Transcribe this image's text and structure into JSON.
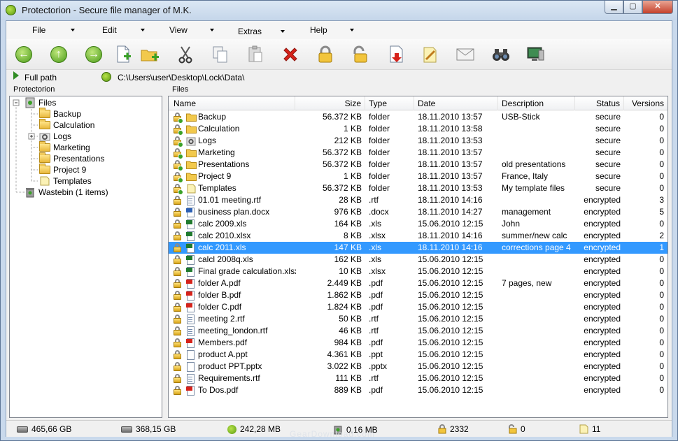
{
  "window": {
    "title": "Protectorion - Secure file manager of M.K.",
    "minimize": "▁",
    "maximize": "▢",
    "close": "✕"
  },
  "menu": [
    {
      "label": "File"
    },
    {
      "label": "Edit"
    },
    {
      "label": "View"
    },
    {
      "label": "Extras"
    },
    {
      "label": "Help"
    }
  ],
  "toolbar": [
    "back-icon",
    "up-icon",
    "forward-icon",
    "new-file-icon",
    "new-folder-icon",
    "cut-icon",
    "copy-icon",
    "paste-icon",
    "delete-icon",
    "lock-icon",
    "unlock-icon",
    "download-icon",
    "edit-note-icon",
    "email-icon",
    "binoculars-icon",
    "monitor-icon"
  ],
  "pathbar": {
    "full_path_label": "Full path",
    "path": "C:\\Users\\user\\Desktop\\Lock\\Data\\"
  },
  "panels": {
    "tree_title": "Protectorion",
    "list_title": "Files"
  },
  "tree": {
    "root": "Files",
    "children": [
      "Backup",
      "Calculation",
      "Logs",
      "Marketing",
      "Presentations",
      "Project 9",
      "Templates"
    ],
    "wastebin": "Wastebin (1 items)"
  },
  "columns": {
    "name": "Name",
    "size": "Size",
    "type": "Type",
    "date": "Date",
    "description": "Description",
    "status": "Status",
    "versions": "Versions"
  },
  "files": [
    {
      "name": "Backup",
      "size": "56.372 KB",
      "type": "folder",
      "date": "18.11.2010 13:57",
      "description": "USB-Stick",
      "status": "secure",
      "versions": "0",
      "icon": "folder"
    },
    {
      "name": "Calculation",
      "size": "1 KB",
      "type": "folder",
      "date": "18.11.2010 13:58",
      "description": "",
      "status": "secure",
      "versions": "0",
      "icon": "folder"
    },
    {
      "name": "Logs",
      "size": "212 KB",
      "type": "folder",
      "date": "18.11.2010 13:53",
      "description": "",
      "status": "secure",
      "versions": "0",
      "icon": "gear"
    },
    {
      "name": "Marketing",
      "size": "56.372 KB",
      "type": "folder",
      "date": "18.11.2010 13:57",
      "description": "",
      "status": "secure",
      "versions": "0",
      "icon": "folder"
    },
    {
      "name": "Presentations",
      "size": "56.372 KB",
      "type": "folder",
      "date": "18.11.2010 13:57",
      "description": "old presentations",
      "status": "secure",
      "versions": "0",
      "icon": "folder"
    },
    {
      "name": "Project 9",
      "size": "1 KB",
      "type": "folder",
      "date": "18.11.2010 13:57",
      "description": "France, Italy",
      "status": "secure",
      "versions": "0",
      "icon": "folder"
    },
    {
      "name": "Templates",
      "size": "56.372 KB",
      "type": "folder",
      "date": "18.11.2010 13:53",
      "description": "My template files",
      "status": "secure",
      "versions": "0",
      "icon": "note"
    },
    {
      "name": "01.01 meeting.rtf",
      "size": "28 KB",
      "type": ".rtf",
      "date": "18.11.2010 14:16",
      "description": "",
      "status": "encrypted",
      "versions": "3",
      "icon": "doc"
    },
    {
      "name": "business plan.docx",
      "size": "976 KB",
      "type": ".docx",
      "date": "18.11.2010 14:27",
      "description": "management",
      "status": "encrypted",
      "versions": "5",
      "icon": "word"
    },
    {
      "name": "calc 2009.xls",
      "size": "164 KB",
      "type": ".xls",
      "date": "15.06.2010 12:15",
      "description": "John",
      "status": "encrypted",
      "versions": "0",
      "icon": "excel"
    },
    {
      "name": "calc 2010.xlsx",
      "size": "8 KB",
      "type": ".xlsx",
      "date": "18.11.2010 14:16",
      "description": "summer/new calc",
      "status": "encrypted",
      "versions": "2",
      "icon": "excel"
    },
    {
      "name": "calc 2011.xls",
      "size": "147 KB",
      "type": ".xls",
      "date": "18.11.2010 14:16",
      "description": "corrections page 4",
      "status": "encrypted",
      "versions": "1",
      "icon": "excel",
      "selected": true
    },
    {
      "name": "calcl 2008q.xls",
      "size": "162 KB",
      "type": ".xls",
      "date": "15.06.2010 12:15",
      "description": "",
      "status": "encrypted",
      "versions": "0",
      "icon": "excel"
    },
    {
      "name": "Final grade calculation.xlsx",
      "size": "10 KB",
      "type": ".xlsx",
      "date": "15.06.2010 12:15",
      "description": "",
      "status": "encrypted",
      "versions": "0",
      "icon": "excel"
    },
    {
      "name": "folder A.pdf",
      "size": "2.449 KB",
      "type": ".pdf",
      "date": "15.06.2010 12:15",
      "description": "7 pages, new",
      "status": "encrypted",
      "versions": "0",
      "icon": "pdf"
    },
    {
      "name": "folder B.pdf",
      "size": "1.862 KB",
      "type": ".pdf",
      "date": "15.06.2010 12:15",
      "description": "",
      "status": "encrypted",
      "versions": "0",
      "icon": "pdf"
    },
    {
      "name": "folder C.pdf",
      "size": "1.824 KB",
      "type": ".pdf",
      "date": "15.06.2010 12:15",
      "description": "",
      "status": "encrypted",
      "versions": "0",
      "icon": "pdf"
    },
    {
      "name": "meeting 2.rtf",
      "size": "50 KB",
      "type": ".rtf",
      "date": "15.06.2010 12:15",
      "description": "",
      "status": "encrypted",
      "versions": "0",
      "icon": "doc"
    },
    {
      "name": "meeting_london.rtf",
      "size": "46 KB",
      "type": ".rtf",
      "date": "15.06.2010 12:15",
      "description": "",
      "status": "encrypted",
      "versions": "0",
      "icon": "doc"
    },
    {
      "name": "Members.pdf",
      "size": "984 KB",
      "type": ".pdf",
      "date": "15.06.2010 12:15",
      "description": "",
      "status": "encrypted",
      "versions": "0",
      "icon": "pdf"
    },
    {
      "name": "product A.ppt",
      "size": "4.361 KB",
      "type": ".ppt",
      "date": "15.06.2010 12:15",
      "description": "",
      "status": "encrypted",
      "versions": "0",
      "icon": "blank"
    },
    {
      "name": "product PPT.pptx",
      "size": "3.022 KB",
      "type": ".pptx",
      "date": "15.06.2010 12:15",
      "description": "",
      "status": "encrypted",
      "versions": "0",
      "icon": "blank"
    },
    {
      "name": "Requirements.rtf",
      "size": "111 KB",
      "type": ".rtf",
      "date": "15.06.2010 12:15",
      "description": "",
      "status": "encrypted",
      "versions": "0",
      "icon": "doc"
    },
    {
      "name": "To Dos.pdf",
      "size": "889 KB",
      "type": ".pdf",
      "date": "15.06.2010 12:15",
      "description": "",
      "status": "encrypted",
      "versions": "0",
      "icon": "pdf"
    }
  ],
  "status": {
    "disk_total": "465,66 GB",
    "disk_free": "368,15 GB",
    "protected_size": "242,28 MB",
    "wastebin_size": "0,16 MB",
    "locked_count": "2332",
    "unlocked_count": "0",
    "versions_count": "11"
  },
  "watermark": "GearDownload.com"
}
